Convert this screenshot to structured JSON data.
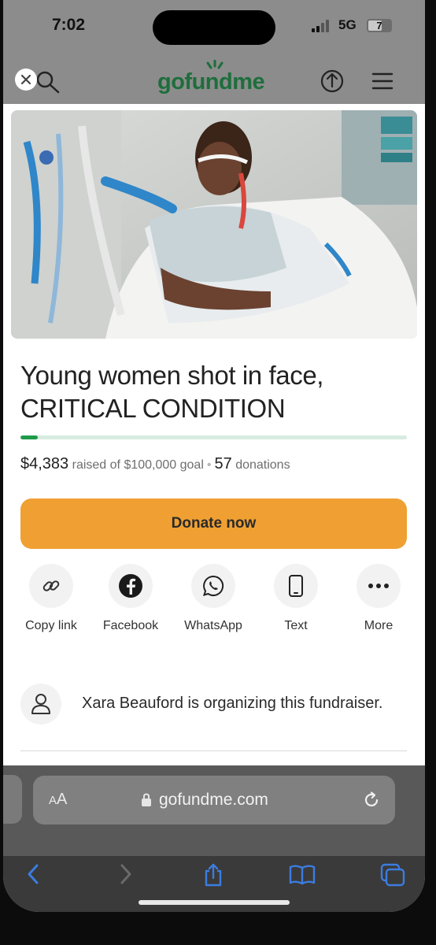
{
  "status_bar": {
    "time": "7:02",
    "network": "5G",
    "battery": "7"
  },
  "header": {
    "logo": "gofundme",
    "icons": [
      "close-icon",
      "search-icon",
      "share-icon",
      "hamburger-menu-icon"
    ]
  },
  "campaign": {
    "hero_image": "hospital-patient-photo",
    "title_line1": "Young women shot in face,",
    "title_line2": "CRITICAL CONDITION",
    "raised": "$4,383",
    "raised_suffix": "raised of $100,000 goal",
    "donations_count": "57",
    "donations_label": "donations",
    "progress_fraction": 0.04383,
    "donate_label": "Donate now"
  },
  "share_options": [
    {
      "label": "Copy link",
      "icon": "link-icon"
    },
    {
      "label": "Facebook",
      "icon": "facebook-icon"
    },
    {
      "label": "WhatsApp",
      "icon": "whatsapp-icon"
    },
    {
      "label": "Text",
      "icon": "phone-icon"
    },
    {
      "label": "More",
      "icon": "more-dots-icon"
    }
  ],
  "organizer": {
    "text": "Xara Beauford is organizing this fundraiser.",
    "icon": "user-icon"
  },
  "browser": {
    "aa_big": "A",
    "aa_small": "A",
    "domain": "gofundme.com",
    "toolbar_icons": [
      "back-icon",
      "forward-icon",
      "share-icon",
      "bookmarks-icon",
      "tabs-icon"
    ]
  },
  "colors": {
    "brand_green": "#1e6e3c",
    "progress_green": "#1f9a4a",
    "donate_orange": "#f0a032",
    "safari_blue": "#3b7de0"
  }
}
